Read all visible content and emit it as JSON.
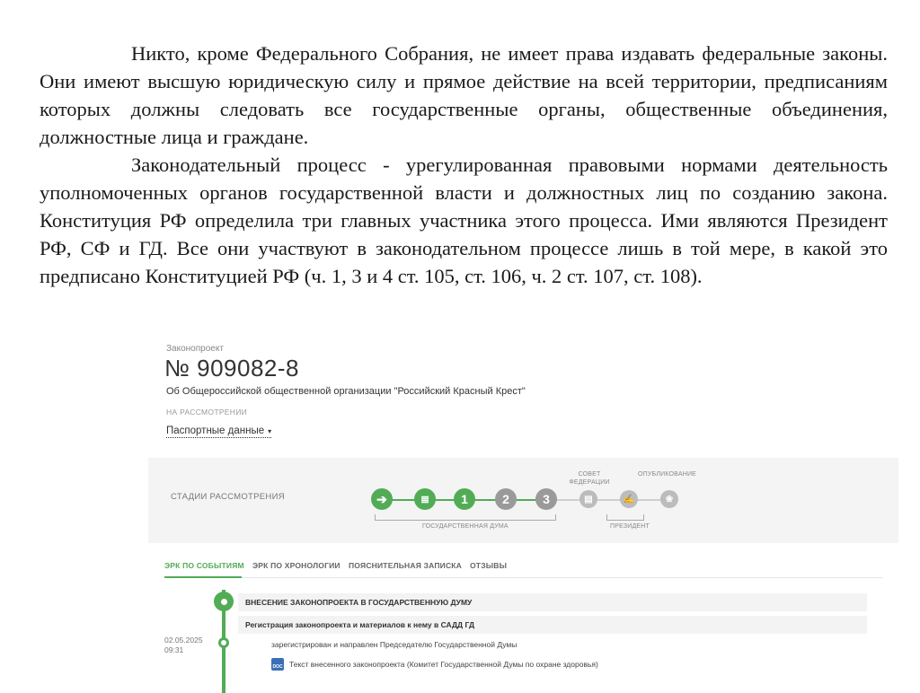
{
  "document": {
    "paragraph1": "Никто, кроме Федерального Собрания, не имеет права издавать федеральные законы. Они имеют высшую юридическую силу и прямое действие на всей территории, предписаниям которых должны следовать все государственные органы, общественные объединения, должностные лица и граждане.",
    "paragraph2": "Законодательный процесс - урегулированная правовыми нормами деятельность уполномоченных органов государственной власти и должностных лиц по созданию закона. Конституция РФ определила три главных участника этого процесса. Ими являются Президент РФ, СФ и ГД. Все они участвуют в законодательном процессе лишь в той мере, в какой это предписано Конституцией РФ (ч. 1, 3 и 4 ст. 105, ст. 106, ч. 2 ст. 107, ст. 108)."
  },
  "bill": {
    "label": "Законопроект",
    "number": "№ 909082-8",
    "title": "Об Общероссийской общественной организации \"Российский Красный Крест\"",
    "status": "НА РАССМОТРЕНИИ",
    "passport_link": "Паспортные данные",
    "caret": "▾"
  },
  "stages": {
    "label": "СТАДИИ РАССМОТРЕНИЯ",
    "federation_council": "СОВЕТ ФЕДЕРАЦИИ",
    "publication": "ОПУБЛИКОВАНИЕ",
    "state_duma": "ГОСУДАРСТВЕННАЯ ДУМА",
    "president": "ПРЕЗИДЕНТ",
    "steps": [
      {
        "symbol": "➔",
        "state": "done"
      },
      {
        "symbol": "≣",
        "state": "done"
      },
      {
        "symbol": "1",
        "state": "done"
      },
      {
        "symbol": "2",
        "state": "pending"
      },
      {
        "symbol": "3",
        "state": "pending"
      },
      {
        "symbol": "▤",
        "state": "future"
      },
      {
        "symbol": "✍",
        "state": "future"
      },
      {
        "symbol": "❀",
        "state": "future"
      }
    ]
  },
  "tabs": [
    {
      "label": "ЭРК ПО СОБЫТИЯМ",
      "active": true
    },
    {
      "label": "ЭРК ПО ХРОНОЛОГИИ",
      "active": false
    },
    {
      "label": "ПОЯСНИТЕЛЬНАЯ ЗАПИСКА",
      "active": false
    },
    {
      "label": "ОТЗЫВЫ",
      "active": false
    }
  ],
  "timeline": {
    "event_title": "ВНЕСЕНИЕ ЗАКОНОПРОЕКТА В ГОСУДАРСТВЕННУЮ ДУМУ",
    "sub_event": "Регистрация законопроекта и материалов к нему в САДД ГД",
    "date": "02.05.2025",
    "time": "09:31",
    "item": "зарегистрирован и направлен Председателю Государственной Думы",
    "doc_icon_label": "DOC",
    "doc_title": "Текст внесенного законопроекта (Комитет Государственной Думы по охране здоровья)"
  },
  "colors": {
    "accent": "#52ac55",
    "pending": "#9a9a9a"
  }
}
